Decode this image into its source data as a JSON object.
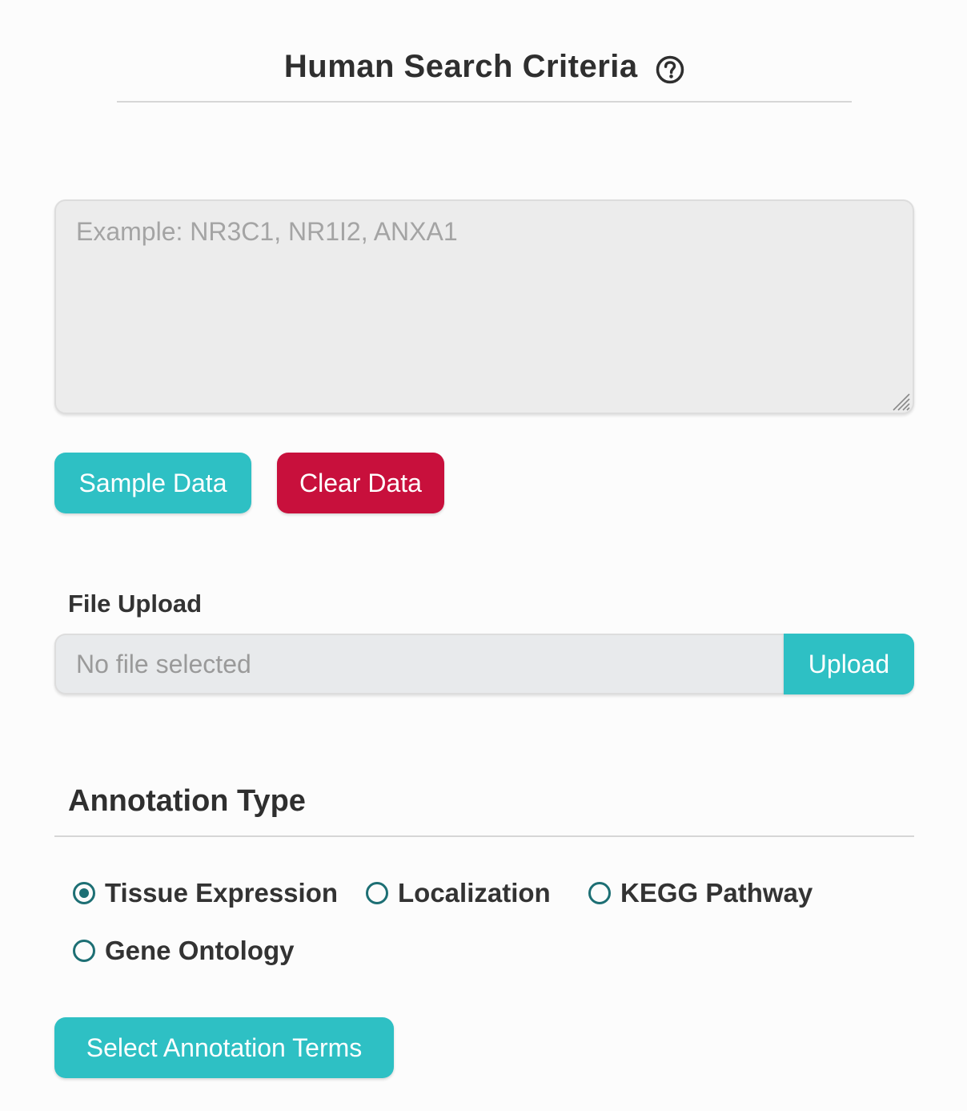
{
  "header": {
    "title": "Human Search Criteria",
    "help_icon": "question-circle-icon"
  },
  "gene_input": {
    "placeholder": "Example: NR3C1, NR1I2, ANXA1",
    "value": ""
  },
  "data_buttons": {
    "sample_label": "Sample Data",
    "clear_label": "Clear Data"
  },
  "file_upload": {
    "label": "File Upload",
    "status": "No file selected",
    "button_label": "Upload"
  },
  "annotation": {
    "title": "Annotation Type",
    "selected": "Tissue Expression",
    "options": [
      {
        "label": "Tissue Expression",
        "checked": true
      },
      {
        "label": "Localization",
        "checked": false
      },
      {
        "label": "KEGG Pathway",
        "checked": false
      },
      {
        "label": "Gene Ontology",
        "checked": false
      }
    ],
    "select_button_label": "Select Annotation Terms"
  },
  "colors": {
    "accent_teal": "#2ec0c4",
    "danger_red": "#c8103c",
    "radio": "#1d6f74"
  }
}
